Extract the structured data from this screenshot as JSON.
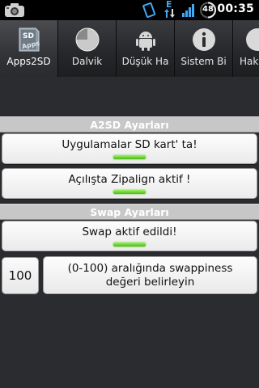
{
  "status_bar": {
    "time": "00:35",
    "battery_level": "48",
    "network_type": "E",
    "icons": [
      "camera-icon",
      "vibrate-icon",
      "data-arrows-icon",
      "signal-icon",
      "battery-icon"
    ]
  },
  "tabs": [
    {
      "label": "Apps2SD",
      "icon": "sd-card-icon",
      "active": true
    },
    {
      "label": "Dalvik",
      "icon": "pie-chart-icon",
      "active": false
    },
    {
      "label": "Düşük Ha",
      "icon": "android-icon",
      "active": false
    },
    {
      "label": "Sistem Bi",
      "icon": "info-icon",
      "active": false
    },
    {
      "label": "Hak",
      "icon": "partial-tab-icon",
      "active": false
    }
  ],
  "tab_icon_text": {
    "sd": "SD",
    "apps": "Apps"
  },
  "a2sd_section": {
    "title": "A2SD Ayarları",
    "buttons": [
      {
        "label": "Uygulamalar SD kart' ta!",
        "indicator": "on"
      },
      {
        "label": "Açılışta Zipalign aktif !",
        "indicator": "on"
      }
    ]
  },
  "swap_section": {
    "title": "Swap Ayarları",
    "toggle_label": "Swap aktif edildi!",
    "toggle_indicator": "on",
    "swappiness_value": "100",
    "swappiness_button": "(0-100) aralığında swappiness değeri belirleyin"
  },
  "colors": {
    "background": "#2b2c30",
    "section_header": "#c7c7c7",
    "indicator_on": "#5fd42a"
  }
}
